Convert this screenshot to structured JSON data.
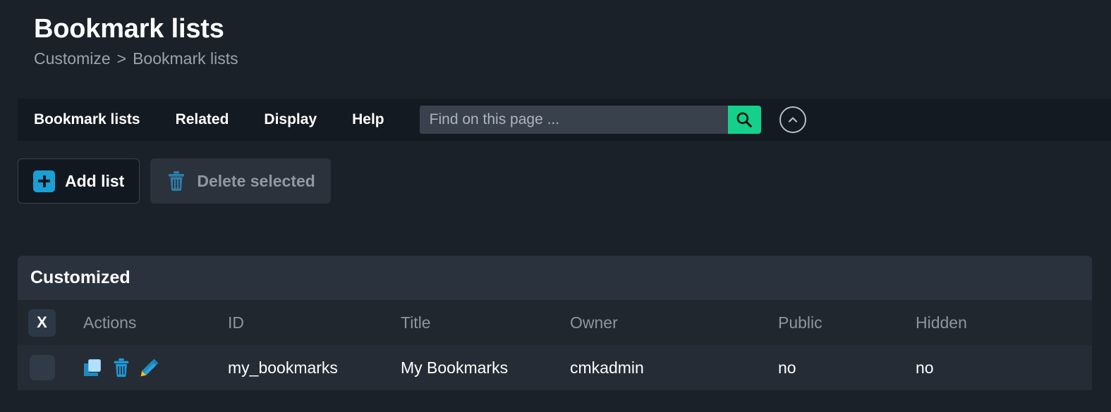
{
  "header": {
    "title": "Bookmark lists",
    "breadcrumb": {
      "parent": "Customize",
      "separator": ">",
      "current": "Bookmark lists"
    }
  },
  "navbar": {
    "items": [
      {
        "label": "Bookmark lists",
        "icon": "nav-item"
      },
      {
        "label": "Related",
        "icon": "nav-item"
      },
      {
        "label": "Display",
        "icon": "nav-item"
      },
      {
        "label": "Help",
        "icon": "nav-item"
      }
    ],
    "search": {
      "value": "",
      "placeholder": "Find on this page ...",
      "icon": "search-icon"
    },
    "collapse": {
      "icon": "chevron-up-icon"
    }
  },
  "toolbar": {
    "add_label": "Add list",
    "add_icon": "plus-icon",
    "delete_label": "Delete selected",
    "delete_icon": "trash-icon",
    "delete_disabled": true
  },
  "table": {
    "caption": "Customized",
    "select_all_label": "X",
    "columns": [
      "Actions",
      "ID",
      "Title",
      "Owner",
      "Public",
      "Hidden"
    ],
    "row_icons": [
      "clone-icon",
      "trash-icon",
      "edit-pencil-icon"
    ],
    "rows": [
      {
        "id": "my_bookmarks",
        "title": "My Bookmarks",
        "owner": "cmkadmin",
        "public": "no",
        "hidden": "no"
      }
    ]
  },
  "colors": {
    "page_bg": "#1b2128",
    "navbar_bg": "#141a21",
    "accent_green": "#15d08a",
    "accent_blue": "#1a9ed4",
    "card_title_bg": "#2a323d",
    "table_head_bg": "#21272f",
    "table_row_bg": "#252c35",
    "muted_text": "#8d959e"
  }
}
